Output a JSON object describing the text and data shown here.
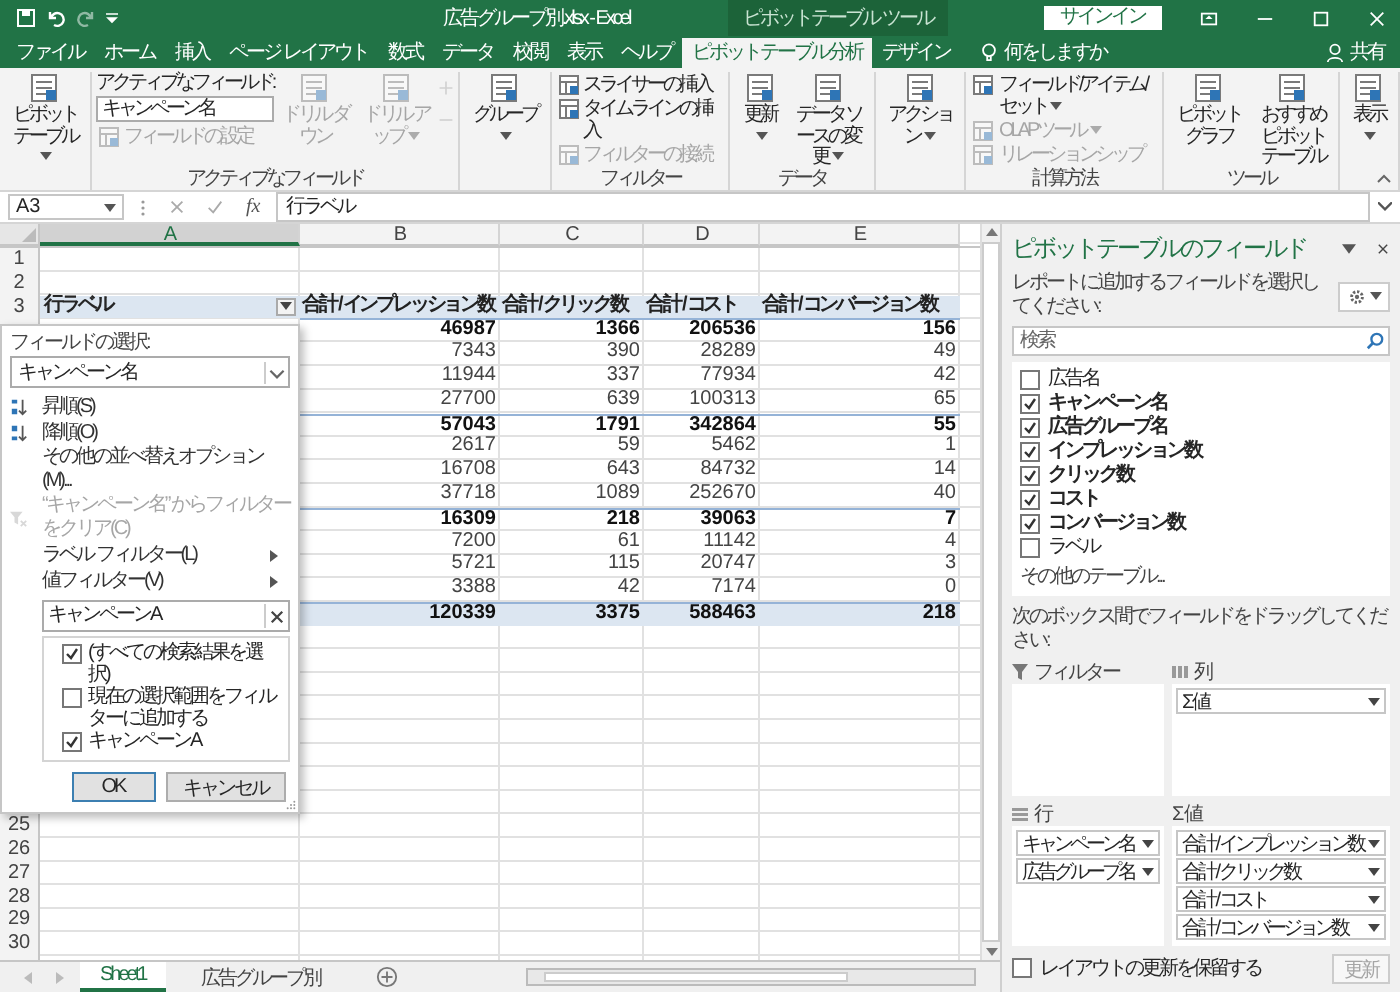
{
  "title_bar": {
    "title": "広告グループ別.xlsx - Excel",
    "context_label": "ピボットテーブル ツール",
    "sign_in": "サインイン"
  },
  "menu_tabs": [
    {
      "label": "ファイル",
      "selected": false
    },
    {
      "label": "ホーム",
      "selected": false
    },
    {
      "label": "挿入",
      "selected": false
    },
    {
      "label": "ページ レイアウト",
      "selected": false
    },
    {
      "label": "数式",
      "selected": false
    },
    {
      "label": "データ",
      "selected": false
    },
    {
      "label": "校閲",
      "selected": false
    },
    {
      "label": "表示",
      "selected": false
    },
    {
      "label": "ヘルプ",
      "selected": false
    },
    {
      "label": "ピボットテーブル分析",
      "selected": true
    },
    {
      "label": "デザイン",
      "selected": false
    }
  ],
  "tell_me": "何をしますか",
  "share": "共有",
  "ribbon": {
    "groups": [
      {
        "columns": [
          [
            {
              "kind": "large",
              "label": "ピボットテーブル",
              "dropdown": true,
              "disabled": false
            }
          ]
        ]
      },
      {
        "label": "アクティブなフィールド",
        "columns": [
          [
            {
              "kind": "field",
              "label": "アクティブなフィールド:",
              "value": "キャンペーン名",
              "disabled": false
            },
            {
              "kind": "small",
              "label": "フィールドの設定",
              "dropdown": false,
              "disabled": true
            }
          ],
          [
            {
              "kind": "large",
              "label": "ドリル ダウン",
              "dropdown": false,
              "disabled": true
            }
          ],
          [
            {
              "kind": "large",
              "label": "ドリル アップ",
              "dropdown": true,
              "disabled": true
            }
          ],
          [
            {
              "kind": "mini",
              "disabled": true
            }
          ]
        ]
      },
      {
        "columns": [
          [
            {
              "kind": "large",
              "label": "グループ",
              "dropdown": true,
              "disabled": false
            }
          ]
        ]
      },
      {
        "label": "フィルター",
        "columns": [
          [
            {
              "kind": "small",
              "label": "スライサーの挿入",
              "dropdown": false,
              "disabled": false
            },
            {
              "kind": "small",
              "label": "タイムラインの挿入",
              "dropdown": false,
              "disabled": false
            },
            {
              "kind": "small",
              "label": "フィルターの接続",
              "dropdown": false,
              "disabled": true
            }
          ]
        ]
      },
      {
        "label": "データ",
        "columns": [
          [
            {
              "kind": "large",
              "label": "更新",
              "dropdown": true,
              "disabled": false
            }
          ],
          [
            {
              "kind": "large",
              "label": "データ ソースの変更",
              "dropdown": true,
              "disabled": false
            }
          ]
        ]
      },
      {
        "columns": [
          [
            {
              "kind": "large",
              "label": "アクション",
              "dropdown": true,
              "disabled": false
            }
          ]
        ]
      },
      {
        "label": "計算方法",
        "columns": [
          [
            {
              "kind": "small",
              "label": "フィールド/アイテム/セット",
              "dropdown": true,
              "disabled": false
            },
            {
              "kind": "small",
              "label": "OLAP ツール",
              "dropdown": true,
              "disabled": true
            },
            {
              "kind": "small",
              "label": "リレーションシップ",
              "dropdown": false,
              "disabled": true
            }
          ]
        ]
      },
      {
        "label": "ツール",
        "columns": [
          [
            {
              "kind": "large",
              "label": "ピボットグラフ",
              "dropdown": false,
              "disabled": false
            }
          ],
          [
            {
              "kind": "large",
              "label": "おすすめピボットテーブル",
              "dropdown": false,
              "disabled": false
            }
          ]
        ]
      },
      {
        "columns": [
          [
            {
              "kind": "large",
              "label": "表示",
              "dropdown": true,
              "disabled": false
            }
          ]
        ]
      }
    ]
  },
  "formula_bar": {
    "name_box": "A3",
    "function_symbol": "fx",
    "formula": "行ラベル"
  },
  "sheet": {
    "columns": [
      {
        "label": "A",
        "selected": true
      },
      {
        "label": "B",
        "selected": false
      },
      {
        "label": "C",
        "selected": false
      },
      {
        "label": "D",
        "selected": false
      },
      {
        "label": "E",
        "selected": false
      }
    ],
    "rows": [
      {
        "kind": "empty",
        "number": "1"
      },
      {
        "kind": "empty",
        "number": "2"
      },
      {
        "kind": "header",
        "number": "3",
        "label": "行ラベル",
        "values": [
          "合計 / インプレッション数",
          "合計 / クリック数",
          "合計 / コスト",
          "合計 / コンバージョン数"
        ]
      },
      {
        "kind": "subtotal",
        "values": [
          "46987",
          "1366",
          "206536",
          "156"
        ]
      },
      {
        "kind": "detail",
        "values": [
          "7343",
          "390",
          "28289",
          "49"
        ]
      },
      {
        "kind": "detail",
        "values": [
          "11944",
          "337",
          "77934",
          "42"
        ]
      },
      {
        "kind": "detail",
        "values": [
          "27700",
          "639",
          "100313",
          "65"
        ]
      },
      {
        "kind": "subtotal",
        "values": [
          "57043",
          "1791",
          "342864",
          "55"
        ]
      },
      {
        "kind": "detail",
        "values": [
          "2617",
          "59",
          "5462",
          "1"
        ]
      },
      {
        "kind": "detail",
        "values": [
          "16708",
          "643",
          "84732",
          "14"
        ]
      },
      {
        "kind": "detail",
        "values": [
          "37718",
          "1089",
          "252670",
          "40"
        ]
      },
      {
        "kind": "subtotal",
        "values": [
          "16309",
          "218",
          "39063",
          "7"
        ]
      },
      {
        "kind": "detail",
        "values": [
          "7200",
          "61",
          "11142",
          "4"
        ]
      },
      {
        "kind": "detail",
        "values": [
          "5721",
          "115",
          "20747",
          "3"
        ]
      },
      {
        "kind": "detail",
        "values": [
          "3388",
          "42",
          "7174",
          "0"
        ]
      },
      {
        "kind": "total",
        "values": [
          "120339",
          "3375",
          "588463",
          "218"
        ]
      },
      {
        "kind": "empty"
      },
      {
        "kind": "empty"
      },
      {
        "kind": "empty"
      },
      {
        "kind": "empty"
      },
      {
        "kind": "empty"
      },
      {
        "kind": "empty"
      },
      {
        "kind": "empty"
      },
      {
        "kind": "empty"
      },
      {
        "kind": "empty",
        "number": "25"
      },
      {
        "kind": "empty",
        "number": "26"
      },
      {
        "kind": "empty",
        "number": "27"
      },
      {
        "kind": "empty",
        "number": "28"
      },
      {
        "kind": "empty",
        "number": "29"
      },
      {
        "kind": "empty",
        "number": "30"
      }
    ]
  },
  "sheet_tabs": [
    {
      "label": "Sheet1",
      "selected": true
    },
    {
      "label": "広告グループ別",
      "selected": false
    }
  ],
  "filter_menu": {
    "field_label": "フィールドの選択:",
    "field_value": "キャンペーン名",
    "items": [
      {
        "kind": "sort_asc",
        "label": "昇順(S)",
        "disabled": false
      },
      {
        "kind": "sort_desc",
        "label": "降順(O)",
        "disabled": false
      },
      {
        "kind": "plain",
        "label": "その他の並べ替えオプション(M)...",
        "disabled": false
      },
      {
        "kind": "clear",
        "label": "“キャンペーン名” からフィルターをクリア(C)",
        "disabled": true
      },
      {
        "kind": "submenu",
        "label": "ラベル フィルター(L)",
        "disabled": false
      },
      {
        "kind": "submenu",
        "label": "値フィルター(V)",
        "disabled": false
      }
    ],
    "search_value": "キャンペーンA",
    "checklist": [
      {
        "label": "(すべての検索結果を選択)",
        "checked": true
      },
      {
        "label": "現在の選択範囲をフィルターに追加する",
        "checked": false
      },
      {
        "label": "キャンペーンA",
        "checked": true
      }
    ],
    "buttons": [
      {
        "label": "OK",
        "default": true
      },
      {
        "label": "キャンセル",
        "default": false
      }
    ]
  },
  "field_panel": {
    "title": "ピボットテーブルのフィールド",
    "subtitle": "レポートに追加するフィールドを選択してください:",
    "search_placeholder": "検索",
    "fields": [
      {
        "label": "広告名",
        "checked": false
      },
      {
        "label": "キャンペーン名",
        "checked": true
      },
      {
        "label": "広告グループ名",
        "checked": true
      },
      {
        "label": "インプレッション数",
        "checked": true
      },
      {
        "label": "クリック数",
        "checked": true
      },
      {
        "label": "コスト",
        "checked": true
      },
      {
        "label": "コンバージョン数",
        "checked": true
      },
      {
        "label": "ラベル",
        "checked": false
      }
    ],
    "more_tables": "その他のテーブル...",
    "drag_hint": "次のボックス間でフィールドをドラッグしてください:",
    "areas": [
      {
        "kind": "filter",
        "label": "フィルター"
      },
      {
        "kind": "columns",
        "label": "列",
        "items": [
          "Σ 値"
        ]
      },
      {
        "kind": "rows",
        "label": "行",
        "items": [
          "キャンペーン名",
          "広告グループ名"
        ]
      },
      {
        "kind": "values",
        "label": "Σ 値",
        "items": [
          "合計 / インプレッション数",
          "合計 / クリック数",
          "合計 / コスト",
          "合計 / コンバージョン数"
        ]
      }
    ],
    "defer": {
      "label": "レイアウトの更新を保留する",
      "checked": false
    },
    "update_button": {
      "label": "更新",
      "disabled": true
    }
  }
}
